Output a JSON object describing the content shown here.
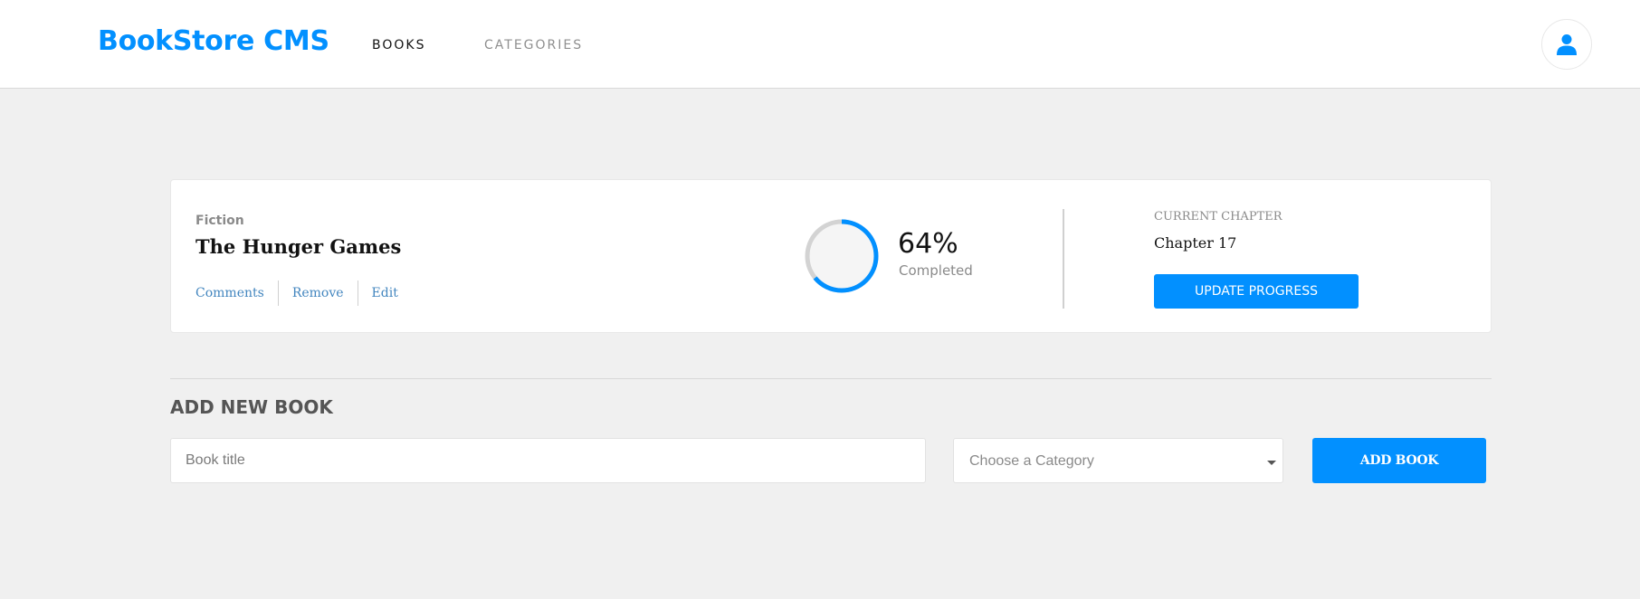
{
  "header": {
    "logo": "BookStore CMS",
    "nav": [
      {
        "label": "BOOKS",
        "active": true
      },
      {
        "label": "CATEGORIES",
        "active": false
      }
    ],
    "user_icon": "user-icon"
  },
  "book": {
    "genre": "Fiction",
    "title": "The Hunger Games",
    "actions": [
      "Comments",
      "Remove",
      "Edit"
    ],
    "progress_percent": 64,
    "progress_text": "64%",
    "completed_label": "Completed",
    "chapter_label": "CURRENT CHAPTER",
    "chapter": "Chapter 17",
    "update_label": "UPDATE PROGRESS"
  },
  "add_form": {
    "title": "ADD NEW BOOK",
    "title_placeholder": "Book title",
    "title_value": "",
    "category_placeholder": "Choose a Category",
    "add_label": "ADD BOOK"
  },
  "colors": {
    "accent": "#0290ff",
    "ring_track": "#d3d3d3",
    "background": "#f0f0f0",
    "link": "#4386bf"
  }
}
